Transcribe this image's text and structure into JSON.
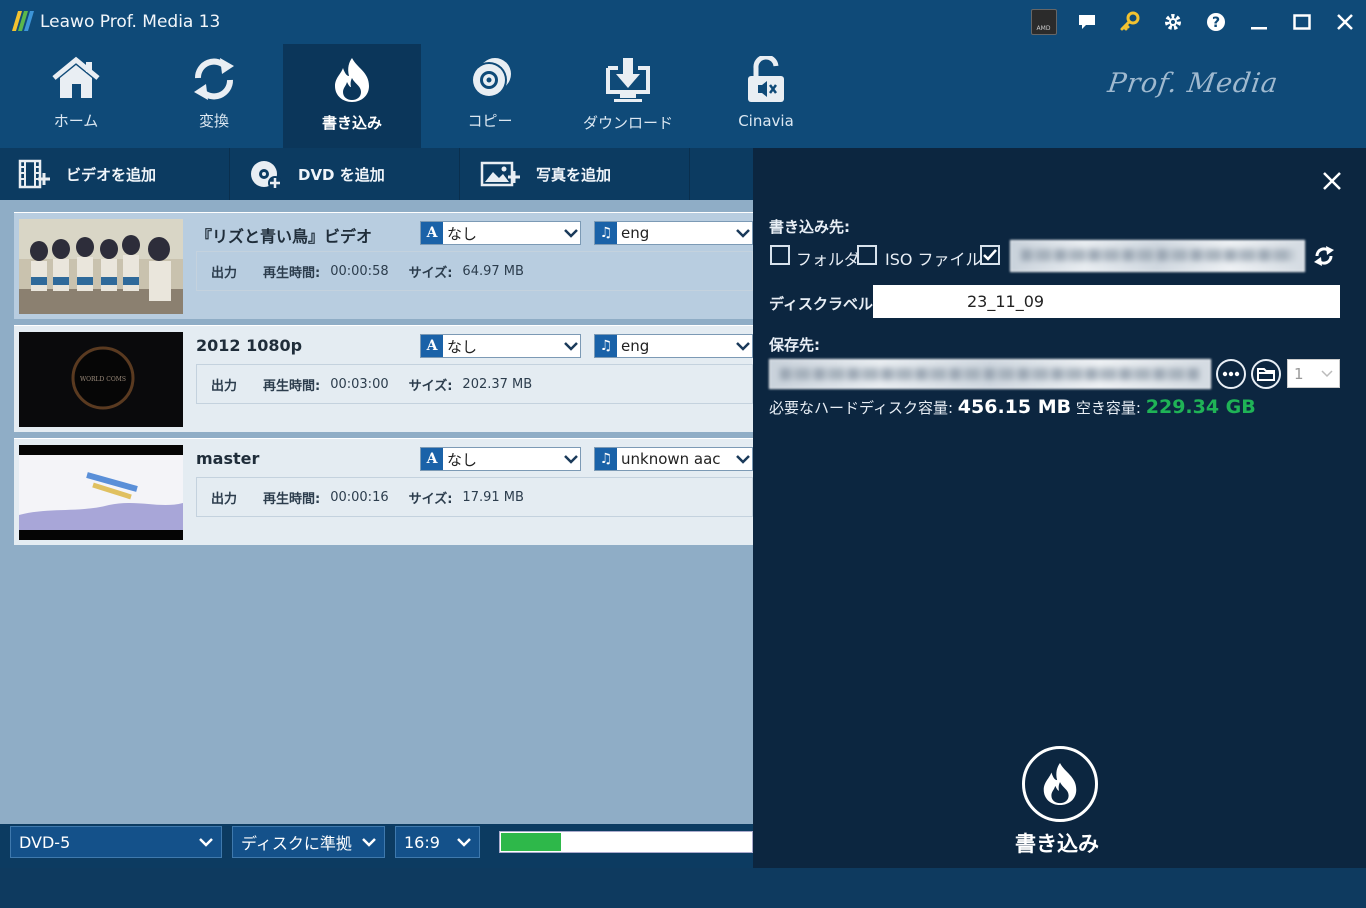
{
  "window": {
    "title": "Leawo Prof. Media 13"
  },
  "nav": {
    "items": [
      {
        "label": "ホーム",
        "icon": "home-icon"
      },
      {
        "label": "変換",
        "icon": "convert-icon"
      },
      {
        "label": "書き込み",
        "icon": "flame-icon",
        "active": true
      },
      {
        "label": "コピー",
        "icon": "disc-copy-icon"
      },
      {
        "label": "ダウンロード",
        "icon": "download-icon"
      },
      {
        "label": "Cinavia",
        "icon": "lock-icon"
      }
    ],
    "brand": "Prof. Media"
  },
  "toolbar": {
    "add_video": "ビデオを追加",
    "add_dvd": "DVD を追加",
    "add_photo": "写真を追加"
  },
  "items": [
    {
      "title": "『リズと青い鳥』ビデオ",
      "subtitle": "なし",
      "audio": "eng",
      "output": "出力",
      "duration_label": "再生時間:",
      "duration": "00:00:58",
      "size_label": "サイズ:",
      "size": "64.97 MB"
    },
    {
      "title": "2012 1080p",
      "subtitle": "なし",
      "audio": "eng",
      "output": "出力",
      "duration_label": "再生時間:",
      "duration": "00:03:00",
      "size_label": "サイズ:",
      "size": "202.37 MB"
    },
    {
      "title": "master",
      "subtitle": "なし",
      "audio": "unknown aac",
      "output": "出力",
      "duration_label": "再生時間:",
      "duration": "00:00:16",
      "size_label": "サイズ:",
      "size": "17.91 MB"
    }
  ],
  "bottom": {
    "disc_type": "DVD-5",
    "quality": "ディスクに準拠",
    "aspect": "16:9",
    "progress": 0.24
  },
  "panel": {
    "target_label": "書き込み先:",
    "folder": "フォルダ",
    "iso": "ISO ファイル",
    "disc_label_label": "ディスクラベル:",
    "disc_label_value": "23_11_09",
    "save_label": "保存先:",
    "copies": "1",
    "required_label": "必要なハードディスク容量:",
    "required_value": "456.15 MB",
    "free_label": "空き容量:",
    "free_value": "229.34 GB",
    "burn_label": "書き込み"
  },
  "colors": {
    "accent_blue": "#0f4a78",
    "panel_dark": "#0c2640",
    "free_green": "#1fb356",
    "progress_green": "#2eb84a"
  }
}
